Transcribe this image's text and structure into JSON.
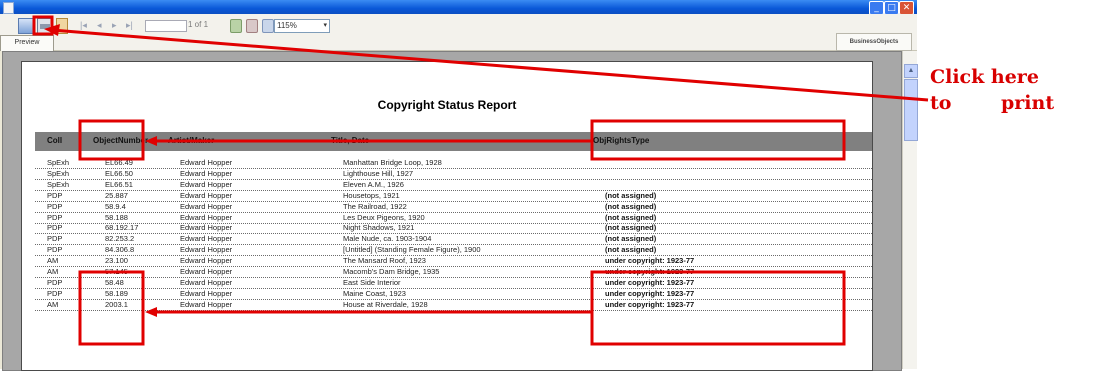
{
  "window": {
    "minimize_glyph": "_",
    "maximize_glyph": "□",
    "close_glyph": "✕"
  },
  "toolbar": {
    "icons": [
      "export-icon",
      "print-icon",
      "page-setup-icon",
      "first-page-icon",
      "prev-page-icon",
      "next-page-icon",
      "last-page-icon",
      "refresh-icon",
      "stop-icon",
      "search-icon"
    ],
    "nav_glyphs": [
      "|◂",
      "◂",
      "▸",
      "▸|"
    ],
    "page_label": "1 of 1",
    "zoom_value": "115%",
    "zoom_arrow": "▾",
    "preview_tab": "Preview",
    "logo_text": "BusinessObjects"
  },
  "report": {
    "title": "Copyright Status Report",
    "columns": [
      "Coll",
      "ObjectNumber",
      "Artist/Maker",
      "Title, Date",
      "ObjRightsType"
    ],
    "rows": [
      {
        "coll": "SpExh",
        "num": "EL66.49",
        "artist": "Edward Hopper",
        "title": "Manhattan Bridge Loop, 1928",
        "rights": ""
      },
      {
        "coll": "SpExh",
        "num": "EL66.50",
        "artist": "Edward Hopper",
        "title": "Lighthouse Hill, 1927",
        "rights": ""
      },
      {
        "coll": "SpExh",
        "num": "EL66.51",
        "artist": "Edward Hopper",
        "title": "Eleven A.M., 1926",
        "rights": ""
      },
      {
        "coll": "PDP",
        "num": "25.887",
        "artist": "Edward Hopper",
        "title": "Housetops, 1921",
        "rights": "(not assigned)"
      },
      {
        "coll": "PDP",
        "num": "58.9.4",
        "artist": "Edward Hopper",
        "title": "The Railroad, 1922",
        "rights": "(not assigned)"
      },
      {
        "coll": "PDP",
        "num": "58.188",
        "artist": "Edward Hopper",
        "title": "Les Deux Pigeons, 1920",
        "rights": "(not assigned)"
      },
      {
        "coll": "PDP",
        "num": "68.192.17",
        "artist": "Edward Hopper",
        "title": "Night Shadows, 1921",
        "rights": "(not assigned)"
      },
      {
        "coll": "PDP",
        "num": "82.253.2",
        "artist": "Edward Hopper",
        "title": "Male Nude, ca. 1903-1904",
        "rights": "(not assigned)"
      },
      {
        "coll": "PDP",
        "num": "84.306.8",
        "artist": "Edward Hopper",
        "title": "[Untitled] (Standing Female Figure), 1900",
        "rights": "(not assigned)"
      },
      {
        "coll": "AM",
        "num": "23.100",
        "artist": "Edward Hopper",
        "title": "The Mansard Roof, 1923",
        "rights": "under copyright: 1923-77"
      },
      {
        "coll": "AM",
        "num": "57.145",
        "artist": "Edward Hopper",
        "title": "Macomb's Dam Bridge, 1935",
        "rights": "under copyright: 1923-77"
      },
      {
        "coll": "PDP",
        "num": "58.48",
        "artist": "Edward Hopper",
        "title": "East Side Interior",
        "rights": "under copyright: 1923-77"
      },
      {
        "coll": "PDP",
        "num": "58.189",
        "artist": "Edward Hopper",
        "title": "Maine Coast, 1923",
        "rights": "under copyright: 1923-77"
      },
      {
        "coll": "AM",
        "num": "2003.1",
        "artist": "Edward Hopper",
        "title": "House at Riverdale, 1928",
        "rights": "under copyright: 1923-77"
      }
    ]
  },
  "callout": {
    "line1": "Click here",
    "line2a": "to",
    "line2b": "print"
  },
  "colors": {
    "annotation": "#e00000",
    "title_bar": "#0a58d8",
    "header_band": "#808080"
  }
}
